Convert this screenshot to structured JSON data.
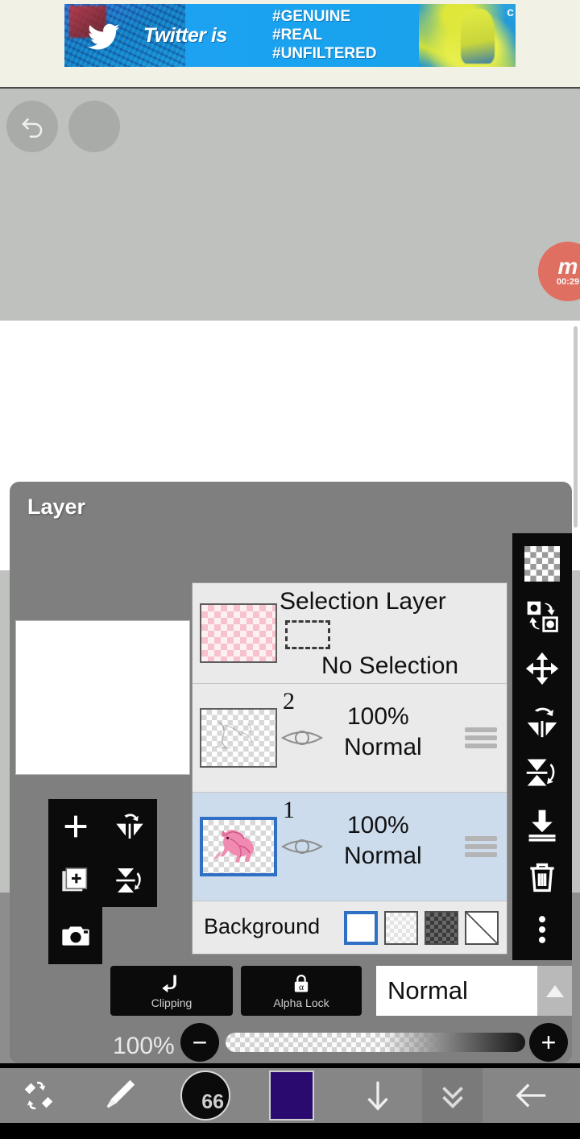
{
  "ad": {
    "brand": "Twitter",
    "headline": "Twitter is",
    "hashtags": [
      "#GENUINE",
      "#REAL",
      "#UNFILTERED"
    ],
    "corner_label": "c",
    "bird_icon": "twitter-bird-icon"
  },
  "canvas": {
    "undo_icon": "undo-arrow-icon",
    "redo_icon": "redo-arrow-icon"
  },
  "recorder": {
    "logo": "m",
    "timer": "00:29"
  },
  "layer_panel": {
    "title": "Layer",
    "left_tools": [
      {
        "name": "add-layer-button",
        "icon": "plus-icon"
      },
      {
        "name": "flip-horizontal-button",
        "icon": "flip-horizontal-icon"
      },
      {
        "name": "duplicate-layer-button",
        "icon": "duplicate-layer-icon"
      },
      {
        "name": "flip-vertical-button",
        "icon": "flip-vertical-icon"
      },
      {
        "name": "camera-import-button",
        "icon": "camera-icon"
      }
    ],
    "right_tools": [
      {
        "name": "transparency-button",
        "icon": "checkerboard-icon"
      },
      {
        "name": "swap-layers-button",
        "icon": "swap-layers-icon"
      },
      {
        "name": "move-layer-button",
        "icon": "move-arrows-icon"
      },
      {
        "name": "rotate-flip-h-button",
        "icon": "flip-horizontal-rotate-icon"
      },
      {
        "name": "rotate-flip-v-button",
        "icon": "flip-vertical-rotate-icon"
      },
      {
        "name": "merge-down-button",
        "icon": "merge-down-icon"
      },
      {
        "name": "delete-layer-button",
        "icon": "trash-icon"
      },
      {
        "name": "more-options-button",
        "icon": "vertical-dots-icon"
      }
    ],
    "rows": {
      "selection": {
        "title": "Selection Layer",
        "status": "No Selection",
        "thumb_kind": "pink-checker",
        "marquee_icon": "dashed-rectangle-icon"
      },
      "layer2": {
        "number": "2",
        "opacity": "100%",
        "blend": "Normal",
        "visible": true,
        "selected": false,
        "eye_icon": "eye-icon",
        "handle_icon": "drag-handle-icon"
      },
      "layer1": {
        "number": "1",
        "opacity": "100%",
        "blend": "Normal",
        "visible": true,
        "selected": true,
        "eye_icon": "eye-icon",
        "handle_icon": "drag-handle-icon"
      },
      "background": {
        "label": "Background",
        "selected_swatch": "white",
        "swatches": [
          {
            "name": "background-white",
            "label": "white"
          },
          {
            "name": "background-light-checker",
            "label": "light checker"
          },
          {
            "name": "background-dark-checker",
            "label": "dark checker"
          },
          {
            "name": "background-none",
            "label": "none"
          }
        ]
      }
    },
    "mode_buttons": {
      "clipping_label": "Clipping",
      "clipping_icon": "clipping-arrow-icon",
      "alpha_lock_label": "Alpha Lock",
      "alpha_lock_icon": "alpha-lock-icon"
    },
    "blend_select": {
      "value": "Normal",
      "arrow_icon": "triangle-up-icon"
    },
    "opacity": {
      "value": "100%",
      "minus_label": "−",
      "plus_label": "+",
      "slider_percent": 100
    }
  },
  "bottom_bar": {
    "items": [
      {
        "name": "brush-eraser-swap-button",
        "icon": "brush-eraser-swap-icon"
      },
      {
        "name": "brush-tool-button",
        "icon": "paintbrush-icon"
      },
      {
        "name": "brush-size-button",
        "icon": "brush-size-icon"
      },
      {
        "name": "color-swatch-button",
        "icon": "color-square-icon"
      },
      {
        "name": "download-button",
        "icon": "down-arrow-icon"
      },
      {
        "name": "collapse-toolbar-button",
        "icon": "double-chevron-down-icon"
      },
      {
        "name": "back-button",
        "icon": "left-arrow-icon"
      }
    ],
    "brush_size": "66",
    "color_hex": "#2a0a6e"
  }
}
